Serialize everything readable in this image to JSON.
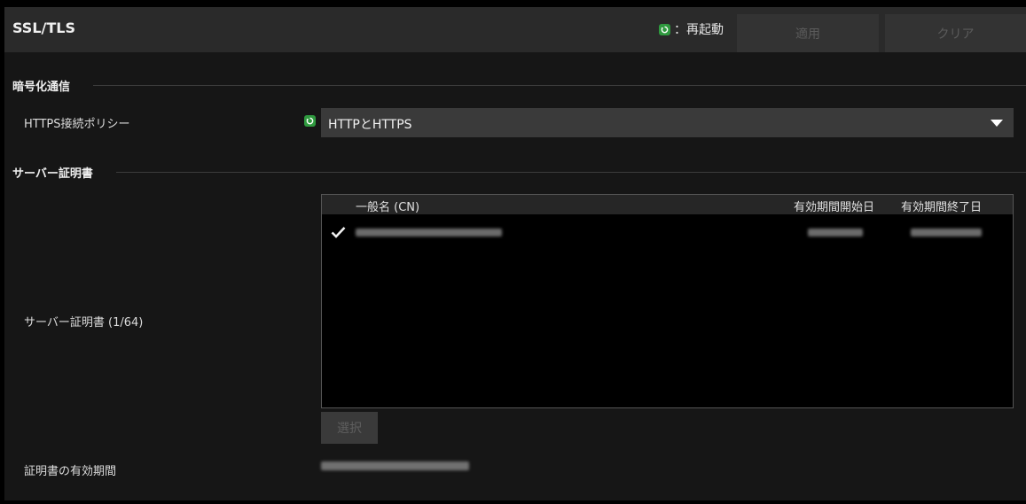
{
  "header": {
    "title": "SSL/TLS",
    "restart_legend": "：再起動",
    "apply_label": "適用",
    "clear_label": "クリア"
  },
  "encryption": {
    "section_title": "暗号化通信",
    "https_policy_label": "HTTPS接続ポリシー",
    "https_policy_value": "HTTPとHTTPS"
  },
  "server_cert": {
    "section_title": "サーバー証明書",
    "list_label": "サーバー証明書 (1/64)",
    "columns": [
      "一般名 (CN)",
      "有効期間開始日",
      "有効期間終了日"
    ],
    "select_button": "選択",
    "validity_label": "証明書の有効期間"
  },
  "colors": {
    "restart_green": "#2f9a3f",
    "header_bg": "#2a2a2a",
    "panel_bg": "#161616"
  }
}
